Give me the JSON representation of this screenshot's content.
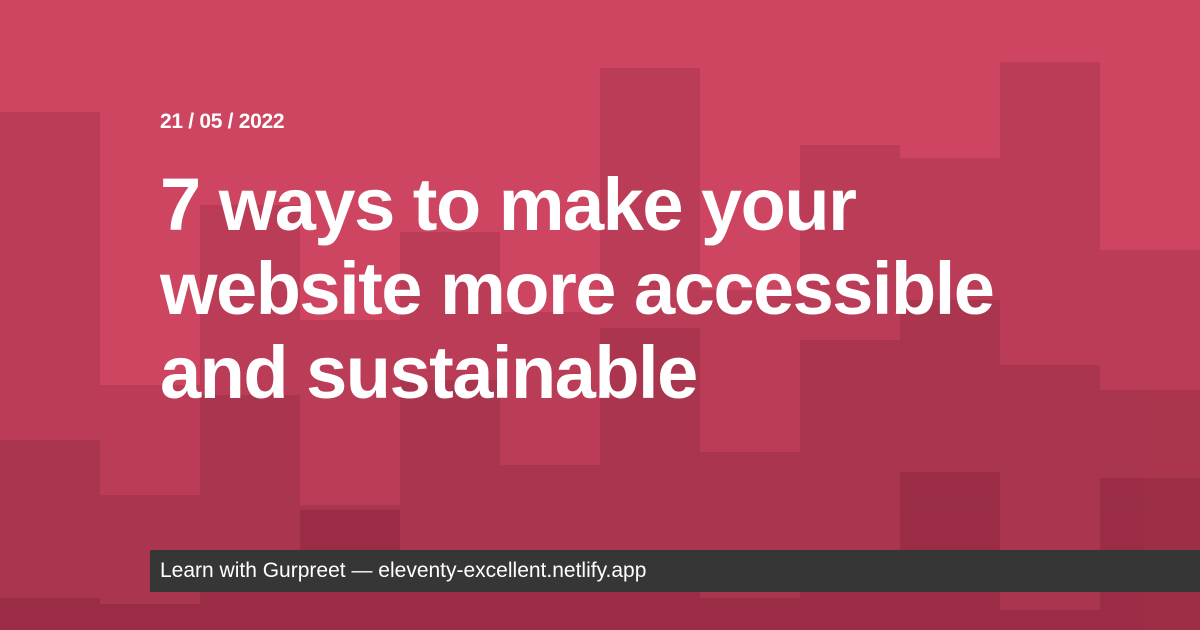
{
  "card": {
    "date": "21 / 05 / 2022",
    "title": "7 ways to make your website more accessible and sustainable",
    "footer": {
      "author_label": "Learn with Gurpreet",
      "separator": "—",
      "site": "eleventy-excellent.netlify.app"
    }
  },
  "colors": {
    "background": "#cd4560",
    "footer_background": "#363636",
    "text": "#ffffff"
  }
}
